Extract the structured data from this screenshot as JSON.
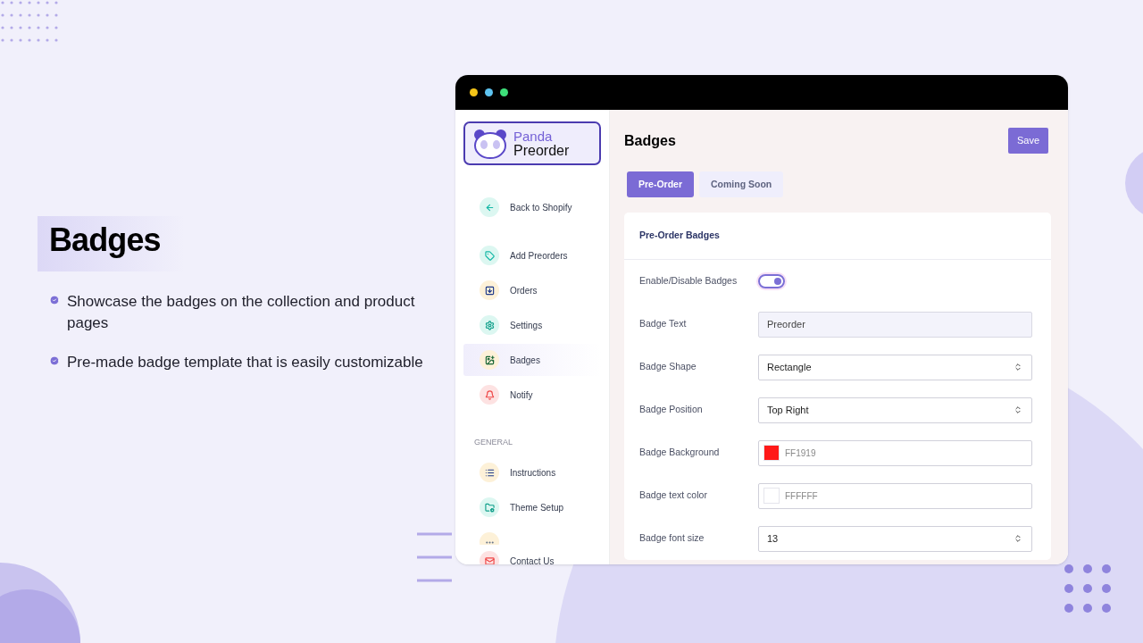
{
  "hero": {
    "title": "Badges",
    "bullets": [
      "Showcase the badges on the collection and product pages",
      "Pre-made badge template that is easily customizable"
    ]
  },
  "window": {
    "logo": {
      "line_1": "Panda",
      "line_2": "Preorder"
    },
    "sidebar": {
      "items": [
        {
          "kind": "back",
          "label": "Back to Shopify",
          "selected": false
        },
        {
          "kind": "item",
          "label": "Add Preorders",
          "selected": false
        },
        {
          "kind": "item",
          "label": "Orders",
          "selected": false
        },
        {
          "kind": "item",
          "label": "Settings",
          "selected": false
        },
        {
          "kind": "item",
          "label": "Badges",
          "selected": true
        },
        {
          "kind": "item",
          "label": "Notify",
          "selected": false
        },
        {
          "kind": "section",
          "label": "GENERAL"
        },
        {
          "kind": "item",
          "label": "Instructions",
          "selected": false
        },
        {
          "kind": "item",
          "label": "Theme Setup",
          "selected": false
        },
        {
          "kind": "clipped"
        },
        {
          "kind": "item",
          "label": "Contact Us",
          "selected": false
        }
      ]
    },
    "page_title": "Badges",
    "save_button": "Save",
    "tabs": [
      {
        "label": "Pre-Order",
        "selected": true
      },
      {
        "label": "Coming Soon",
        "selected": false
      }
    ],
    "card": {
      "title": "Pre-Order Badges",
      "rows": [
        {
          "kind": "toggle",
          "label": "Enable/Disable Badges",
          "on": true
        },
        {
          "kind": "text",
          "label": "Badge Text",
          "value": "Preorder"
        },
        {
          "kind": "select",
          "label": "Badge Shape",
          "value": "Rectangle"
        },
        {
          "kind": "select",
          "label": "Badge Position",
          "value": "Top Right"
        },
        {
          "kind": "color",
          "label": "Badge Background",
          "value": "FF1919",
          "color": "#ff1919"
        },
        {
          "kind": "color",
          "label": "Badge text color",
          "value": "FFFFFF",
          "color": "#ffffff"
        },
        {
          "kind": "select",
          "label": "Badge font size",
          "value": "13"
        }
      ]
    }
  }
}
